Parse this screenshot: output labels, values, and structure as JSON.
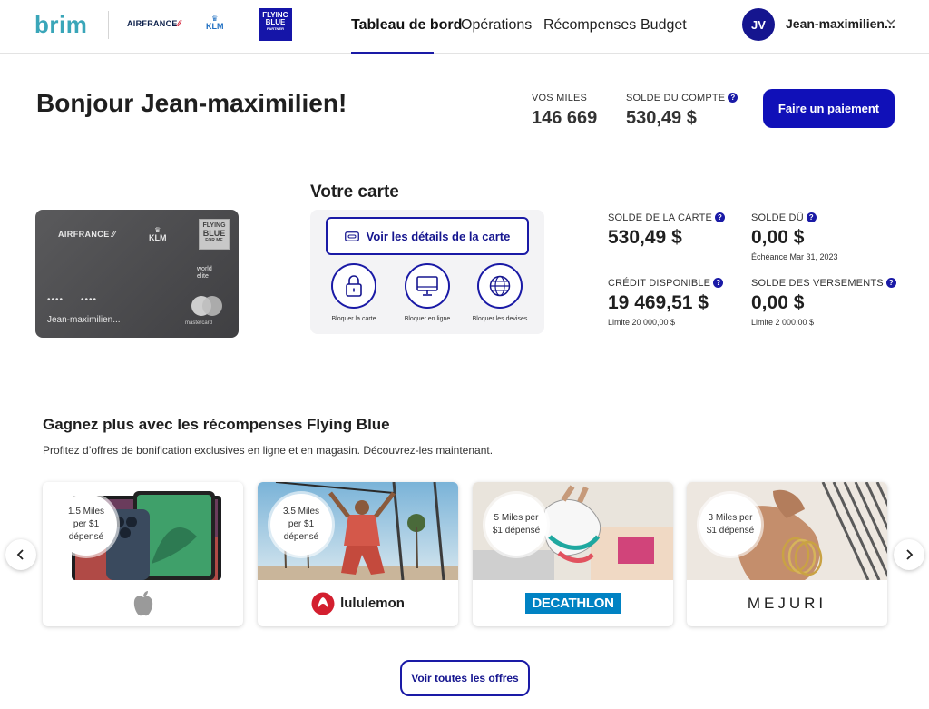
{
  "header": {
    "brand": "brim",
    "partners": {
      "airfrance": "AIRFRANCE",
      "klm": "KLM",
      "flying_blue_line1": "FLYING",
      "flying_blue_line2": "BLUE",
      "flying_blue_line3": "PARTNER"
    },
    "nav": [
      {
        "label": "Tableau de bord",
        "active": true
      },
      {
        "label": "Opérations",
        "active": false
      },
      {
        "label": "Récompenses",
        "active": false
      },
      {
        "label": "Budget",
        "active": false
      }
    ],
    "user": {
      "initials": "JV",
      "name": "Jean-maximilien..."
    }
  },
  "summary": {
    "greeting": "Bonjour Jean-maximilien!",
    "miles_label": "VOS MILES",
    "miles_value": "146 669",
    "balance_label": "SOLDE DU COMPTE",
    "balance_value": "530,49 $",
    "pay_button": "Faire un paiement"
  },
  "card": {
    "section_title": "Votre carte",
    "card_face": {
      "airfrance": "AIRFRANCE",
      "klm": "KLM",
      "flying_blue_line1": "FLYING",
      "flying_blue_line2": "BLUE",
      "flying_blue_line3": "FOR ME",
      "world_line1": "world",
      "world_line2": "elite",
      "dots1": "••••",
      "dots2": "••••",
      "holder": "Jean-maximilien...",
      "network": "mastercard"
    },
    "details_button": "Voir les détails de la carte",
    "actions": [
      {
        "label": "Bloquer la carte",
        "icon": "lock-icon"
      },
      {
        "label": "Bloquer en ligne",
        "icon": "monitor-icon"
      },
      {
        "label": "Bloquer les devises",
        "icon": "globe-icon"
      }
    ]
  },
  "balances": {
    "card_balance_label": "SOLDE DE LA CARTE",
    "card_balance_value": "530,49 $",
    "due_label": "SOLDE DÛ",
    "due_value": "0,00 $",
    "due_sub": "Échéance Mar 31, 2023",
    "credit_label": "CRÉDIT DISPONIBLE",
    "credit_value": "19 469,51 $",
    "credit_sub": "Limite 20 000,00 $",
    "installments_label": "SOLDE DES VERSEMENTS",
    "installments_value": "0,00 $",
    "installments_sub": "Limite 2 000,00 $"
  },
  "rewards": {
    "title": "Gagnez plus avec les récompenses Flying Blue",
    "subtitle": "Profitez d’offres de bonification exclusives en ligne et en magasin. Découvrez-les maintenant.",
    "offers": [
      {
        "badge_l1": "1.5 Miles",
        "badge_l2": "per $1",
        "badge_l3": "dépensé",
        "brand": "apple"
      },
      {
        "badge_l1": "3.5 Miles",
        "badge_l2": "per $1",
        "badge_l3": "dépensé",
        "brand": "lululemon"
      },
      {
        "badge_l1": "5 Miles per",
        "badge_l2": "$1 dépensé",
        "badge_l3": "",
        "brand": "DECATHLON"
      },
      {
        "badge_l1": "3 Miles per",
        "badge_l2": "$1 dépensé",
        "badge_l3": "",
        "brand": "MEJURI"
      }
    ],
    "all_offers_button": "Voir toutes les offres"
  },
  "colors": {
    "brand_teal": "#3aa6b9",
    "primary_blue": "#1010b8",
    "card_gray": "#4a4a4d"
  }
}
